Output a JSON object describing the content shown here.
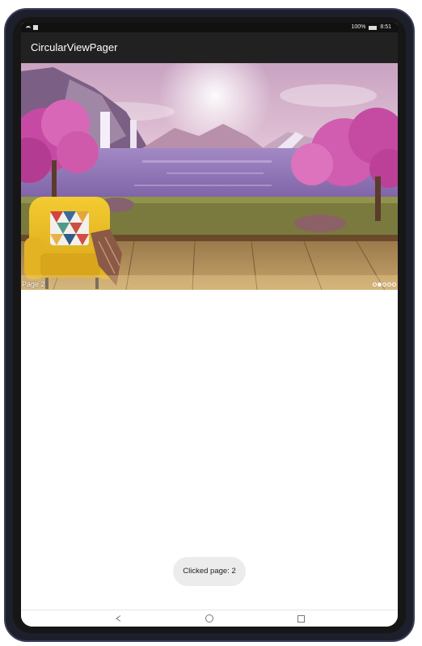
{
  "status_bar": {
    "battery_text": "100%",
    "time": "8:51"
  },
  "app_bar": {
    "title": "CircularViewPager"
  },
  "pager": {
    "current_page_label": "Page 2",
    "page_count": 5,
    "active_index": 1,
    "image_icon": "landscape-image-icon"
  },
  "toast": {
    "message": "Clicked page: 2"
  },
  "nav_bar": {
    "back_icon": "back-triangle-icon",
    "home_icon": "home-circle-icon",
    "recents_icon": "recents-square-icon"
  },
  "colors": {
    "app_bar": "#212121",
    "toast_bg": "#ececec",
    "device_frame": "#1d1f2b"
  }
}
